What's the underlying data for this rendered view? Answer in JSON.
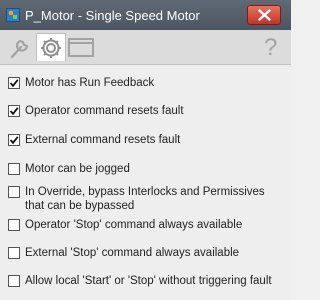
{
  "window": {
    "title": "P_Motor - Single Speed Motor",
    "icon": "faceplate-app-icon"
  },
  "toolbar": {
    "tabs": [
      {
        "name": "maintenance",
        "icon": "wrench-icon",
        "selected": false
      },
      {
        "name": "configuration",
        "icon": "gear-icon",
        "selected": true
      },
      {
        "name": "faceplate",
        "icon": "window-icon",
        "selected": false
      }
    ],
    "help_label": "?"
  },
  "options": [
    {
      "label": "Motor has Run Feedback",
      "checked": true
    },
    {
      "label": "Operator command resets fault",
      "checked": true
    },
    {
      "label": "External command resets fault",
      "checked": true
    },
    {
      "label": "Motor can be jogged",
      "checked": false
    },
    {
      "label": "In Override, bypass Interlocks and Permissives that can be bypassed",
      "checked": false
    },
    {
      "label": "Operator 'Stop' command always available",
      "checked": false
    },
    {
      "label": "External 'Stop' command always available",
      "checked": false
    },
    {
      "label": "Allow local 'Start' or 'Stop' without triggering fault",
      "checked": false
    }
  ],
  "colors": {
    "titlebar": "#525c66",
    "close_button": "#d04a3a",
    "panel": "#eeeeee"
  }
}
